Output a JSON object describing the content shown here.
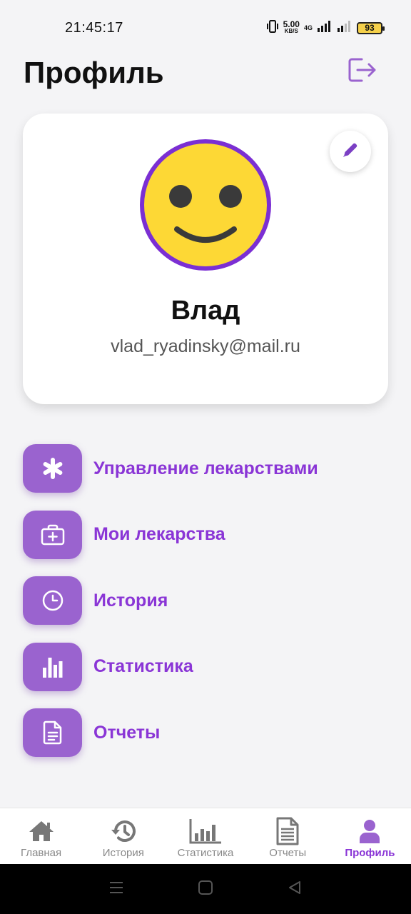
{
  "status_bar": {
    "time": "21:45:17",
    "net_speed_value": "5.00",
    "net_speed_unit": "KB/S",
    "network_type": "4G",
    "battery": "93"
  },
  "header": {
    "title": "Профиль",
    "logout_icon": "logout-icon"
  },
  "profile": {
    "name": "Влад",
    "email": "vlad_ryadinsky@mail.ru",
    "avatar": "smiley-face-avatar",
    "edit_icon": "pencil-icon"
  },
  "menu": [
    {
      "label": "Управление лекарствами",
      "icon": "asterisk-icon"
    },
    {
      "label": "Мои лекарства",
      "icon": "medical-case-icon"
    },
    {
      "label": "История",
      "icon": "clock-icon"
    },
    {
      "label": "Статистика",
      "icon": "bar-chart-icon"
    },
    {
      "label": "Отчеты",
      "icon": "document-icon"
    }
  ],
  "bottom_nav": [
    {
      "label": "Главная",
      "icon": "home-icon",
      "active": false
    },
    {
      "label": "История",
      "icon": "history-icon",
      "active": false
    },
    {
      "label": "Статистика",
      "icon": "bar-chart-icon",
      "active": false
    },
    {
      "label": "Отчеты",
      "icon": "document-icon",
      "active": false
    },
    {
      "label": "Профиль",
      "icon": "user-icon",
      "active": true
    }
  ],
  "colors": {
    "accent": "#8a35d6",
    "menu_icon_bg": "#9a63cf",
    "avatar_face": "#fdd835",
    "avatar_ring": "#7b2fd3",
    "background": "#f4f4f6"
  }
}
